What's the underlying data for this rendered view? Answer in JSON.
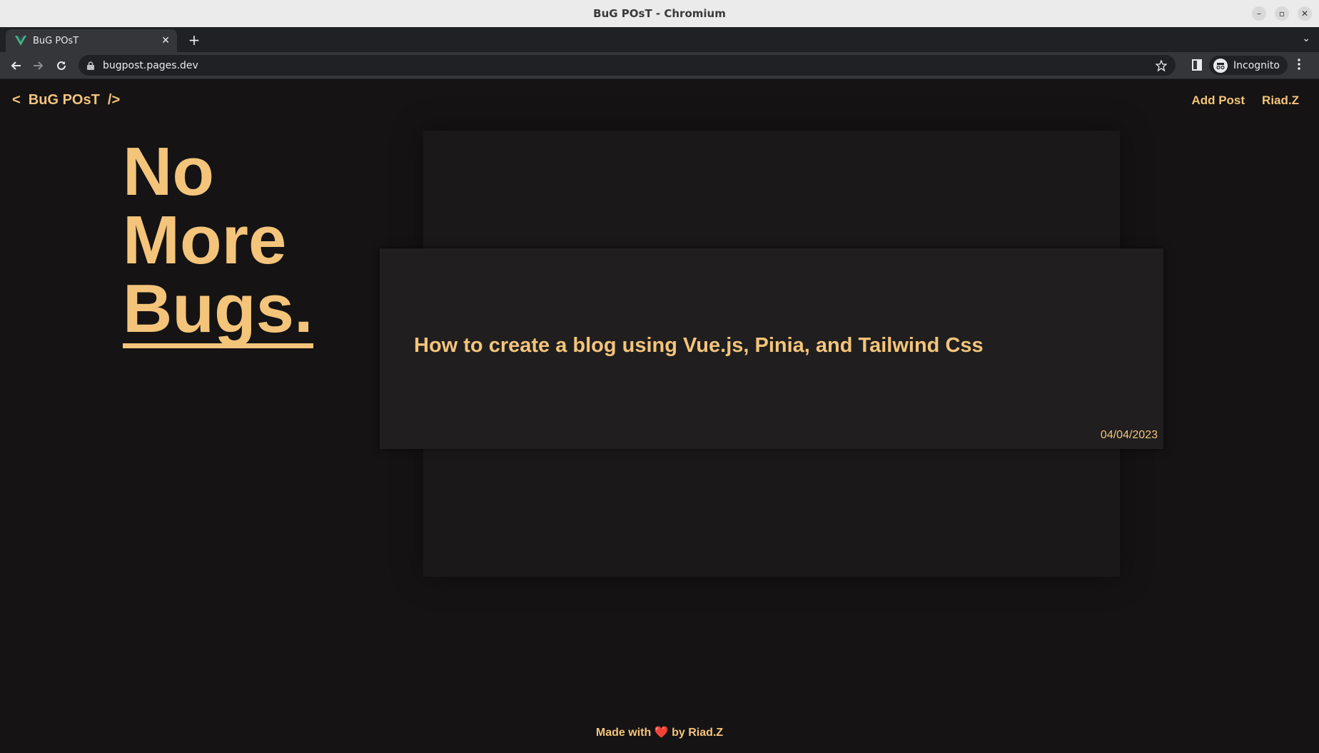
{
  "window": {
    "title": "BuG POsT - Chromium",
    "controls": {
      "minimize": "–",
      "restore": "▫",
      "close": "✕"
    }
  },
  "browser": {
    "tab": {
      "title": "BuG POsT",
      "close": "✕",
      "favicon": "vue-logo-icon"
    },
    "new_tab": "+",
    "tab_menu": "⌄",
    "url": "bugpost.pages.dev",
    "incognito_label": "Incognito"
  },
  "site": {
    "logo": "<  BuG POsT  />",
    "nav": {
      "add_post": "Add Post",
      "user": "Riad.Z"
    },
    "hero": {
      "line1": "No",
      "line2": "More",
      "line3": "Bugs."
    },
    "post": {
      "title": "How to create a blog using Vue.js, Pinia, and Tailwind Css",
      "date": "04/04/2023"
    },
    "footer": {
      "before": "Made with ",
      "heart": "❤️",
      "after": " by Riad.Z"
    }
  },
  "colors": {
    "accent": "#f3c47a",
    "page_background": "#151314",
    "card_background": "#201e1f",
    "heart": "#e0453b"
  }
}
